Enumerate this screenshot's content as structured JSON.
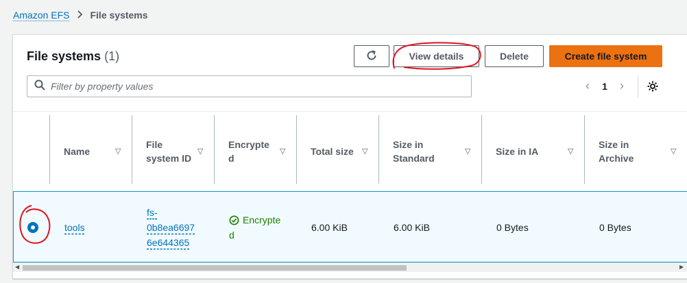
{
  "breadcrumb": {
    "root": "Amazon EFS",
    "current": "File systems"
  },
  "panel": {
    "title": "File systems",
    "count": "(1)"
  },
  "toolbar": {
    "refresh_icon": "refresh-icon",
    "view_details": "View details",
    "delete": "Delete",
    "create": "Create file system"
  },
  "search": {
    "placeholder": "Filter by property values",
    "value": ""
  },
  "pagination": {
    "page": "1"
  },
  "columns": [
    {
      "l1": "Name",
      "l2": ""
    },
    {
      "l1": "File",
      "l2": "system ID"
    },
    {
      "l1": "Encrypte",
      "l2": "d"
    },
    {
      "l1": "Total size",
      "l2": ""
    },
    {
      "l1": "Size in",
      "l2": "Standard"
    },
    {
      "l1": "Size in IA",
      "l2": ""
    },
    {
      "l1": "Size in",
      "l2": "Archive"
    }
  ],
  "rows": [
    {
      "name": "tools",
      "id_l1": "fs-",
      "id_l2": "0b8ea6697",
      "id_l3": "6e644365",
      "enc_l1": "Encrypte",
      "enc_l2": "d",
      "total": "6.00 KiB",
      "standard": "6.00 KiB",
      "ia": "0 Bytes",
      "archive": "0 Bytes"
    }
  ],
  "colors": {
    "accent": "#0073bb",
    "primary": "#ec7211",
    "success": "#1d8102",
    "annotation": "#e0141e"
  }
}
